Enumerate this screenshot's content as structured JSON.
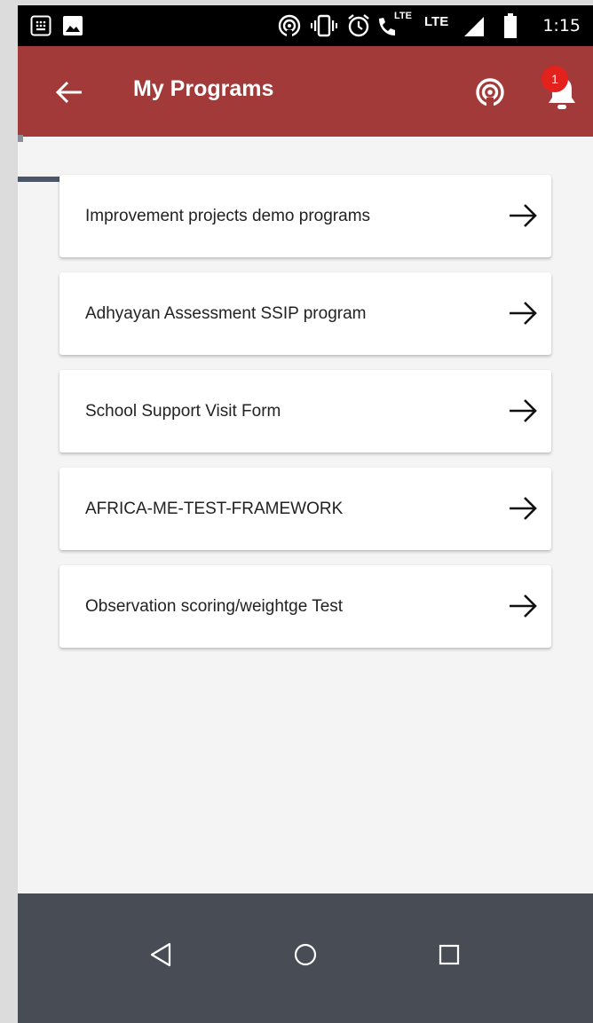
{
  "status_bar": {
    "time": "1:15",
    "lte_labels": [
      "LTE",
      "LTE"
    ],
    "icons": [
      "keypad-icon",
      "image-icon",
      "hotspot-icon",
      "vibrate-icon",
      "alarm-icon",
      "volte-call-icon",
      "signal-icon",
      "battery-icon"
    ]
  },
  "app_bar": {
    "title": "My Programs",
    "notification_count": "1",
    "background_color": "#a23a3a"
  },
  "programs": [
    {
      "name": "Improvement projects demo programs"
    },
    {
      "name": "Adhyayan Assessment SSIP program"
    },
    {
      "name": "School Support Visit Form"
    },
    {
      "name": "AFRICA-ME-TEST-FRAMEWORK"
    },
    {
      "name": "Observation scoring/weightge Test"
    }
  ],
  "nav_bar": {
    "buttons": [
      "back-triangle-icon",
      "home-circle-icon",
      "recents-square-icon"
    ]
  }
}
